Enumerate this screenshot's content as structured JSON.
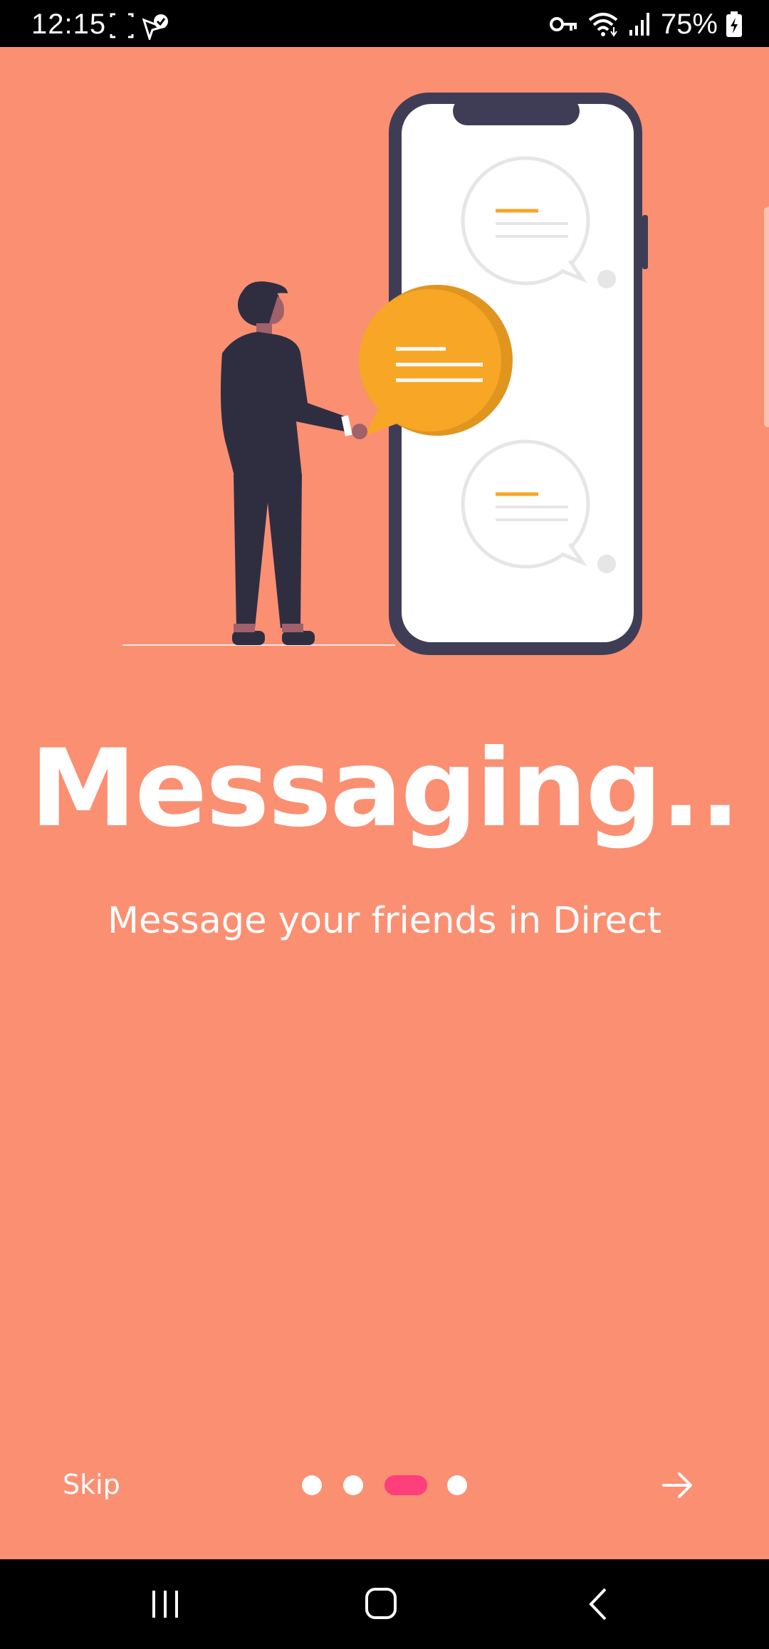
{
  "status_bar": {
    "time": "12:15",
    "battery": "75%",
    "icons": [
      "screenshot-icon",
      "location-check-icon",
      "vpn-key-icon",
      "wifi-icon",
      "signal-icon",
      "battery-charging-icon"
    ]
  },
  "onboarding": {
    "title": "Messaging..",
    "subtitle": "Message your friends in Direct",
    "skip_label": "Skip",
    "page_indicator": {
      "total": 4,
      "current": 3
    },
    "next_icon": "arrow-right-icon"
  },
  "colors": {
    "background": "#fb8f72",
    "active_dot": "#ff3e7c",
    "accent_bubble": "#f7a626",
    "phone_frame": "#3f3d56"
  },
  "nav_bar": {
    "icons": [
      "recent-apps-icon",
      "home-icon",
      "back-icon"
    ]
  }
}
